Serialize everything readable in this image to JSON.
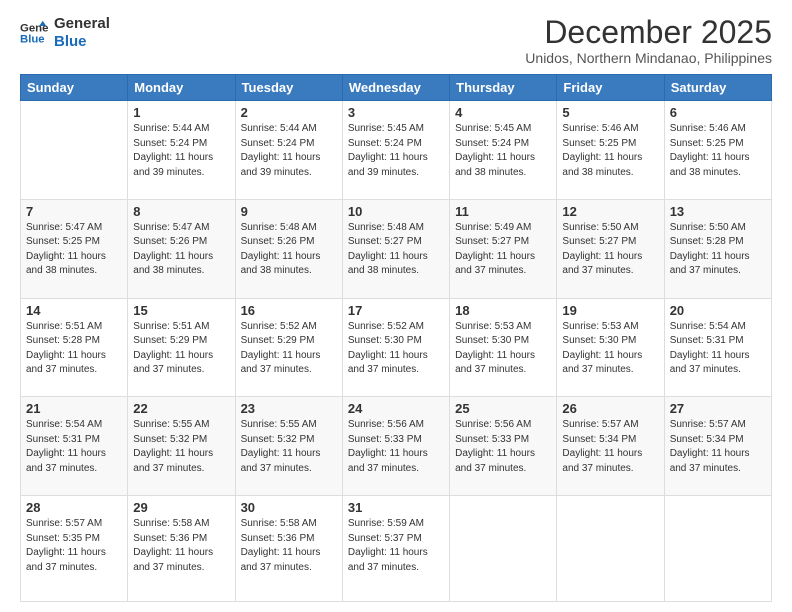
{
  "logo": {
    "line1": "General",
    "line2": "Blue"
  },
  "title": "December 2025",
  "location": "Unidos, Northern Mindanao, Philippines",
  "days_of_week": [
    "Sunday",
    "Monday",
    "Tuesday",
    "Wednesday",
    "Thursday",
    "Friday",
    "Saturday"
  ],
  "weeks": [
    [
      {
        "day": "",
        "info": ""
      },
      {
        "day": "1",
        "info": "Sunrise: 5:44 AM\nSunset: 5:24 PM\nDaylight: 11 hours\nand 39 minutes."
      },
      {
        "day": "2",
        "info": "Sunrise: 5:44 AM\nSunset: 5:24 PM\nDaylight: 11 hours\nand 39 minutes."
      },
      {
        "day": "3",
        "info": "Sunrise: 5:45 AM\nSunset: 5:24 PM\nDaylight: 11 hours\nand 39 minutes."
      },
      {
        "day": "4",
        "info": "Sunrise: 5:45 AM\nSunset: 5:24 PM\nDaylight: 11 hours\nand 38 minutes."
      },
      {
        "day": "5",
        "info": "Sunrise: 5:46 AM\nSunset: 5:25 PM\nDaylight: 11 hours\nand 38 minutes."
      },
      {
        "day": "6",
        "info": "Sunrise: 5:46 AM\nSunset: 5:25 PM\nDaylight: 11 hours\nand 38 minutes."
      }
    ],
    [
      {
        "day": "7",
        "info": "Sunrise: 5:47 AM\nSunset: 5:25 PM\nDaylight: 11 hours\nand 38 minutes."
      },
      {
        "day": "8",
        "info": "Sunrise: 5:47 AM\nSunset: 5:26 PM\nDaylight: 11 hours\nand 38 minutes."
      },
      {
        "day": "9",
        "info": "Sunrise: 5:48 AM\nSunset: 5:26 PM\nDaylight: 11 hours\nand 38 minutes."
      },
      {
        "day": "10",
        "info": "Sunrise: 5:48 AM\nSunset: 5:27 PM\nDaylight: 11 hours\nand 38 minutes."
      },
      {
        "day": "11",
        "info": "Sunrise: 5:49 AM\nSunset: 5:27 PM\nDaylight: 11 hours\nand 37 minutes."
      },
      {
        "day": "12",
        "info": "Sunrise: 5:50 AM\nSunset: 5:27 PM\nDaylight: 11 hours\nand 37 minutes."
      },
      {
        "day": "13",
        "info": "Sunrise: 5:50 AM\nSunset: 5:28 PM\nDaylight: 11 hours\nand 37 minutes."
      }
    ],
    [
      {
        "day": "14",
        "info": "Sunrise: 5:51 AM\nSunset: 5:28 PM\nDaylight: 11 hours\nand 37 minutes."
      },
      {
        "day": "15",
        "info": "Sunrise: 5:51 AM\nSunset: 5:29 PM\nDaylight: 11 hours\nand 37 minutes."
      },
      {
        "day": "16",
        "info": "Sunrise: 5:52 AM\nSunset: 5:29 PM\nDaylight: 11 hours\nand 37 minutes."
      },
      {
        "day": "17",
        "info": "Sunrise: 5:52 AM\nSunset: 5:30 PM\nDaylight: 11 hours\nand 37 minutes."
      },
      {
        "day": "18",
        "info": "Sunrise: 5:53 AM\nSunset: 5:30 PM\nDaylight: 11 hours\nand 37 minutes."
      },
      {
        "day": "19",
        "info": "Sunrise: 5:53 AM\nSunset: 5:30 PM\nDaylight: 11 hours\nand 37 minutes."
      },
      {
        "day": "20",
        "info": "Sunrise: 5:54 AM\nSunset: 5:31 PM\nDaylight: 11 hours\nand 37 minutes."
      }
    ],
    [
      {
        "day": "21",
        "info": "Sunrise: 5:54 AM\nSunset: 5:31 PM\nDaylight: 11 hours\nand 37 minutes."
      },
      {
        "day": "22",
        "info": "Sunrise: 5:55 AM\nSunset: 5:32 PM\nDaylight: 11 hours\nand 37 minutes."
      },
      {
        "day": "23",
        "info": "Sunrise: 5:55 AM\nSunset: 5:32 PM\nDaylight: 11 hours\nand 37 minutes."
      },
      {
        "day": "24",
        "info": "Sunrise: 5:56 AM\nSunset: 5:33 PM\nDaylight: 11 hours\nand 37 minutes."
      },
      {
        "day": "25",
        "info": "Sunrise: 5:56 AM\nSunset: 5:33 PM\nDaylight: 11 hours\nand 37 minutes."
      },
      {
        "day": "26",
        "info": "Sunrise: 5:57 AM\nSunset: 5:34 PM\nDaylight: 11 hours\nand 37 minutes."
      },
      {
        "day": "27",
        "info": "Sunrise: 5:57 AM\nSunset: 5:34 PM\nDaylight: 11 hours\nand 37 minutes."
      }
    ],
    [
      {
        "day": "28",
        "info": "Sunrise: 5:57 AM\nSunset: 5:35 PM\nDaylight: 11 hours\nand 37 minutes."
      },
      {
        "day": "29",
        "info": "Sunrise: 5:58 AM\nSunset: 5:36 PM\nDaylight: 11 hours\nand 37 minutes."
      },
      {
        "day": "30",
        "info": "Sunrise: 5:58 AM\nSunset: 5:36 PM\nDaylight: 11 hours\nand 37 minutes."
      },
      {
        "day": "31",
        "info": "Sunrise: 5:59 AM\nSunset: 5:37 PM\nDaylight: 11 hours\nand 37 minutes."
      },
      {
        "day": "",
        "info": ""
      },
      {
        "day": "",
        "info": ""
      },
      {
        "day": "",
        "info": ""
      }
    ]
  ]
}
